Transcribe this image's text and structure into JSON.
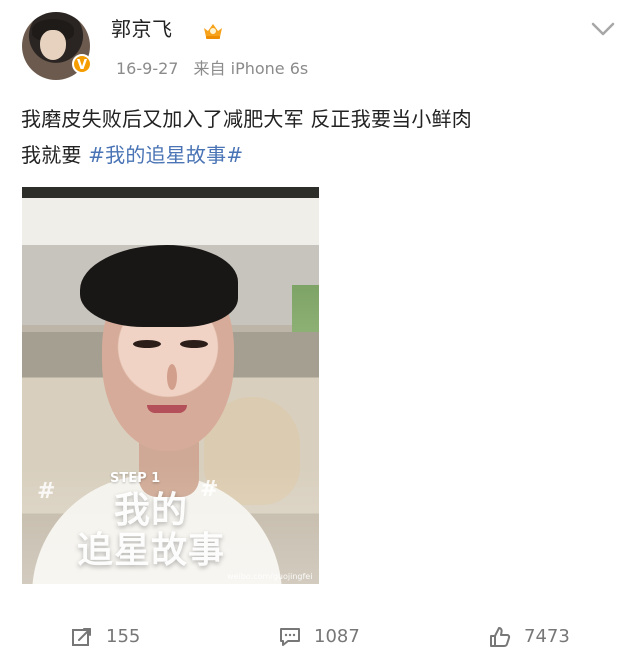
{
  "user": {
    "name": "郭京飞",
    "verified_badge": "V",
    "vip_icon": "crown-icon"
  },
  "meta": {
    "date": "16-9-27",
    "source": "来自 iPhone 6s"
  },
  "post": {
    "text": "我磨皮失败后又加入了减肥大军 反正我要当小鲜肉",
    "text_line2": "我就要 ",
    "hashtag": "#我的追星故事#"
  },
  "image": {
    "step": "STEP 1",
    "title_line1": "我的",
    "title_line2": "追星故事",
    "hash_left": "#",
    "hash_right": "#",
    "watermark": "weibo.com/guojingfei"
  },
  "actions": {
    "repost_count": "155",
    "comment_count": "1087",
    "like_count": "7473"
  },
  "colors": {
    "hashtag": "#4a74b5",
    "meta_text": "#8b8b8b",
    "verified_badge": "#f59d00"
  }
}
